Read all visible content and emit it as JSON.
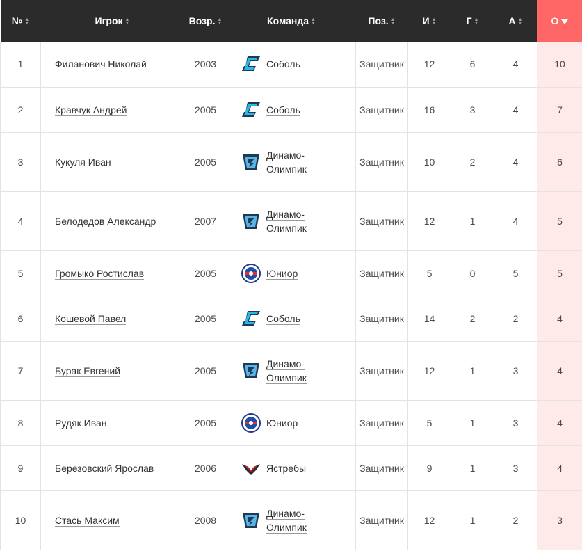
{
  "columns": {
    "num": "№",
    "player": "Игрок",
    "age": "Возр.",
    "team": "Команда",
    "pos": "Поз.",
    "games": "И",
    "goals": "Г",
    "assists": "А",
    "points": "О"
  },
  "sorted_column": "points",
  "colors": {
    "header_bg": "#2b2b2b",
    "active_header": "#ff6666",
    "active_cell": "#ffeaea"
  },
  "rows": [
    {
      "num": "1",
      "player": "Филанович Николай",
      "age": "2003",
      "team_line1": "Соболь",
      "team_line2": "",
      "logo": "sobol-logo",
      "pos": "Защитник",
      "games": "12",
      "goals": "6",
      "assists": "4",
      "points": "10"
    },
    {
      "num": "2",
      "player": "Кравчук Андрей",
      "age": "2005",
      "team_line1": "Соболь",
      "team_line2": "",
      "logo": "sobol-logo",
      "pos": "Защитник",
      "games": "16",
      "goals": "3",
      "assists": "4",
      "points": "7"
    },
    {
      "num": "3",
      "player": "Кукуля Иван",
      "age": "2005",
      "team_line1": "Динамо-",
      "team_line2": "Олимпик",
      "logo": "dinamo-olimpik-logo",
      "pos": "Защитник",
      "games": "10",
      "goals": "2",
      "assists": "4",
      "points": "6"
    },
    {
      "num": "4",
      "player": "Белодедов Александр",
      "age": "2007",
      "team_line1": "Динамо-",
      "team_line2": "Олимпик",
      "logo": "dinamo-olimpik-logo",
      "pos": "Защитник",
      "games": "12",
      "goals": "1",
      "assists": "4",
      "points": "5"
    },
    {
      "num": "5",
      "player": "Громыко Ростислав",
      "age": "2005",
      "team_line1": "Юниор",
      "team_line2": "",
      "logo": "junior-logo",
      "pos": "Защитник",
      "games": "5",
      "goals": "0",
      "assists": "5",
      "points": "5"
    },
    {
      "num": "6",
      "player": "Кошевой Павел",
      "age": "2005",
      "team_line1": "Соболь",
      "team_line2": "",
      "logo": "sobol-logo",
      "pos": "Защитник",
      "games": "14",
      "goals": "2",
      "assists": "2",
      "points": "4"
    },
    {
      "num": "7",
      "player": "Бурак Евгений",
      "age": "2005",
      "team_line1": "Динамо-",
      "team_line2": "Олимпик",
      "logo": "dinamo-olimpik-logo",
      "pos": "Защитник",
      "games": "12",
      "goals": "1",
      "assists": "3",
      "points": "4"
    },
    {
      "num": "8",
      "player": "Рудяк Иван",
      "age": "2005",
      "team_line1": "Юниор",
      "team_line2": "",
      "logo": "junior-logo",
      "pos": "Защитник",
      "games": "5",
      "goals": "1",
      "assists": "3",
      "points": "4"
    },
    {
      "num": "9",
      "player": "Березовский Ярослав",
      "age": "2006",
      "team_line1": "Ястребы",
      "team_line2": "",
      "logo": "yastreby-logo",
      "pos": "Защитник",
      "games": "9",
      "goals": "1",
      "assists": "3",
      "points": "4"
    },
    {
      "num": "10",
      "player": "Стась Максим",
      "age": "2008",
      "team_line1": "Динамо-",
      "team_line2": "Олимпик",
      "logo": "dinamo-olimpik-logo",
      "pos": "Защитник",
      "games": "12",
      "goals": "1",
      "assists": "2",
      "points": "3"
    }
  ]
}
